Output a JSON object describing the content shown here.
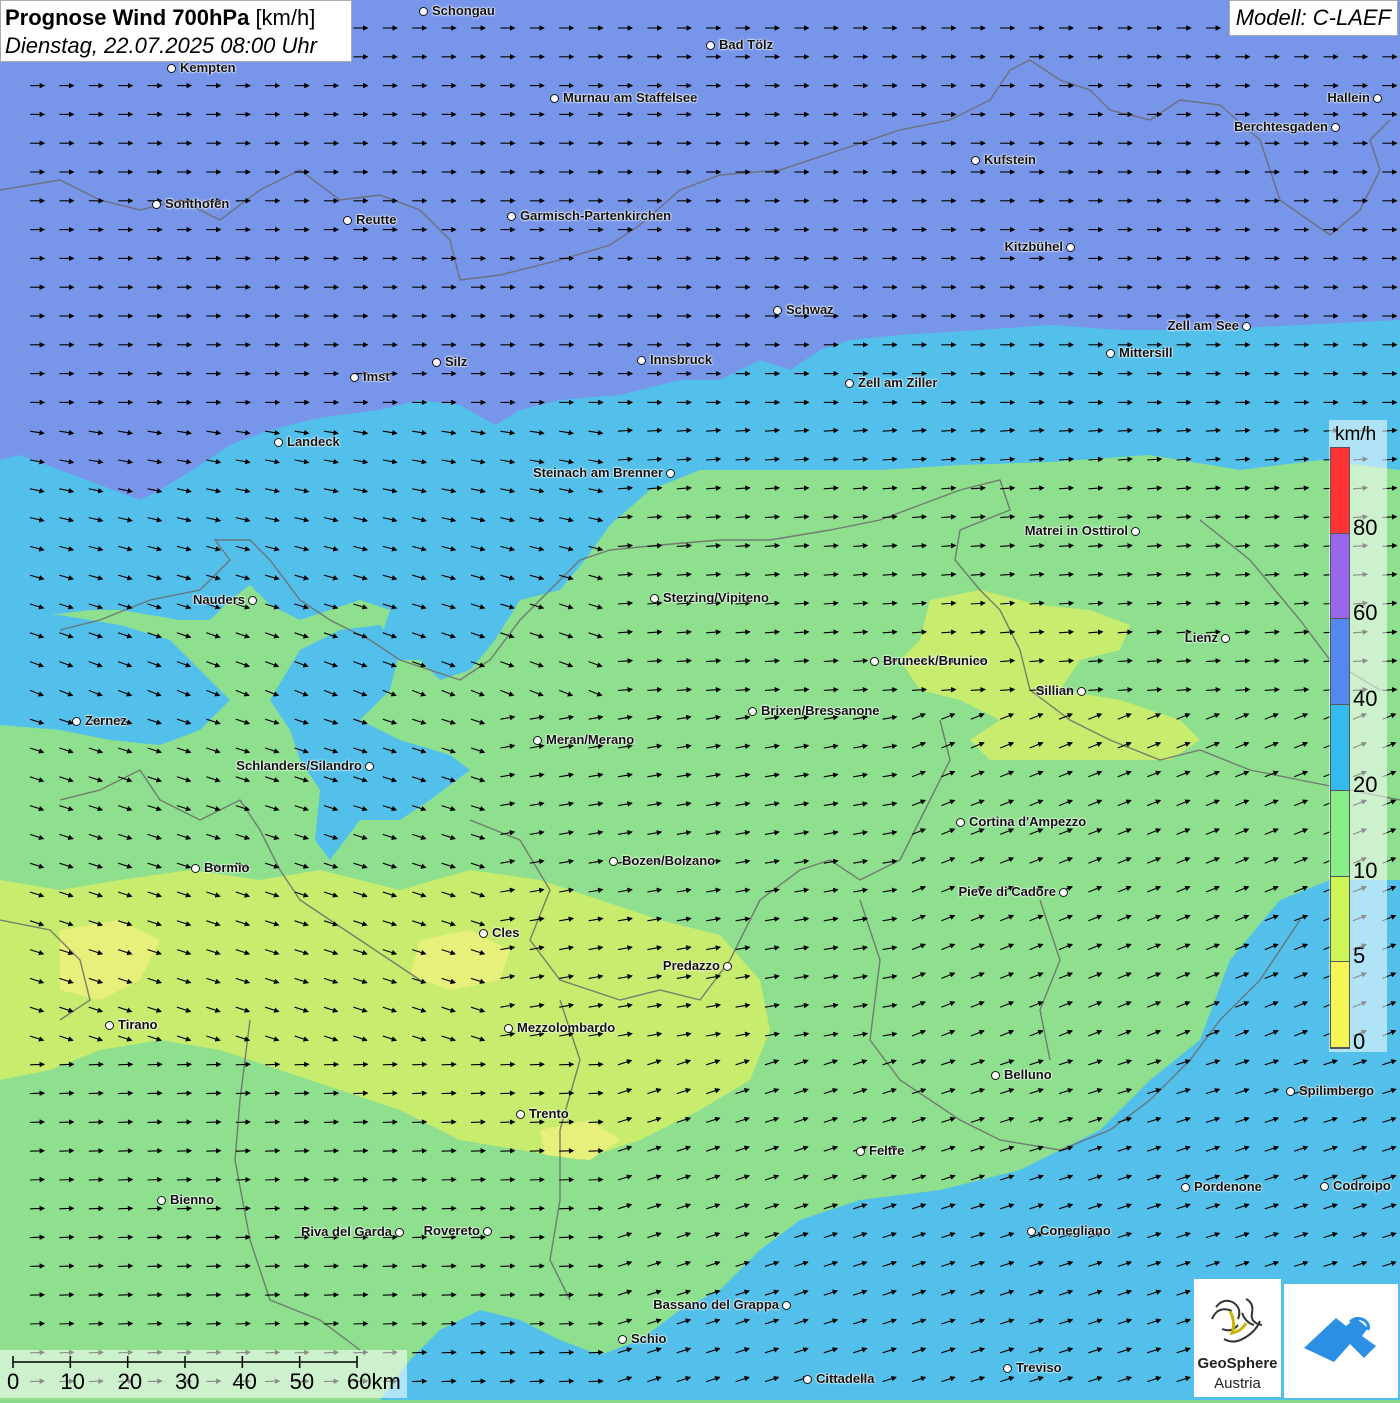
{
  "title": {
    "main": "Prognose Wind 700hPa",
    "unit": "[km/h]",
    "datetime": "Dienstag, 22.07.2025 08:00 Uhr"
  },
  "model": "Modell: C-LAEF",
  "legend": {
    "unit": "km/h",
    "labels": [
      "80",
      "60",
      "40",
      "20",
      "10",
      "5",
      "0"
    ],
    "colors": [
      "#ff3333",
      "#9966ee",
      "#5588ee",
      "#33bbee",
      "#88ee88",
      "#ccf555",
      "#f5f555"
    ]
  },
  "scale": {
    "labels": [
      "0",
      "10",
      "20",
      "30",
      "40",
      "50",
      "60km"
    ]
  },
  "logo": {
    "line1": "GeoSphere",
    "line2": "Austria"
  },
  "colors": {
    "wind_40_60": "#7896e9",
    "wind_20_40": "#52c0ea",
    "wind_10_20": "#8ee08e",
    "wind_5_10": "#c8ec6e",
    "wind_0_5": "#e7f07a"
  },
  "cities": [
    {
      "name": "Schongau"
    },
    {
      "name": "Bad Tölz"
    },
    {
      "name": "Kempten"
    },
    {
      "name": "Murnau am Staffelsee"
    },
    {
      "name": "Hallein"
    },
    {
      "name": "Berchtesgaden"
    },
    {
      "name": "Kufstein"
    },
    {
      "name": "Sonthofen"
    },
    {
      "name": "Reutte"
    },
    {
      "name": "Garmisch-Partenkirchen"
    },
    {
      "name": "Kitzbühel"
    },
    {
      "name": "Schwaz"
    },
    {
      "name": "Zell am See"
    },
    {
      "name": "Mittersill"
    },
    {
      "name": "Innsbruck"
    },
    {
      "name": "Silz"
    },
    {
      "name": "Imst"
    },
    {
      "name": "Zell am Ziller"
    },
    {
      "name": "Landeck"
    },
    {
      "name": "Steinach am Brenner"
    },
    {
      "name": "Matrei in Osttirol"
    },
    {
      "name": "Nauders"
    },
    {
      "name": "Sterzing/Vipiteno"
    },
    {
      "name": "Lienz"
    },
    {
      "name": "Bruneck/Brunico"
    },
    {
      "name": "Sillian"
    },
    {
      "name": "Zernez"
    },
    {
      "name": "Brixen/Bressanone"
    },
    {
      "name": "Meran/Merano"
    },
    {
      "name": "Schlanders/Silandro"
    },
    {
      "name": "Cortina d'Ampezzo"
    },
    {
      "name": "Bozen/Bolzano"
    },
    {
      "name": "Bormio"
    },
    {
      "name": "Pieve di Cadore"
    },
    {
      "name": "Cles"
    },
    {
      "name": "Predazzo"
    },
    {
      "name": "Tirano"
    },
    {
      "name": "Mezzolombardo"
    },
    {
      "name": "Belluno"
    },
    {
      "name": "Spilimbergo"
    },
    {
      "name": "Trento"
    },
    {
      "name": "Feltre"
    },
    {
      "name": "Pordenone"
    },
    {
      "name": "Codroipo"
    },
    {
      "name": "Bienno"
    },
    {
      "name": "Riva del Garda"
    },
    {
      "name": "Rovereto"
    },
    {
      "name": "Conegliano"
    },
    {
      "name": "Bassano del Grappa"
    },
    {
      "name": "Schio"
    },
    {
      "name": "Treviso"
    },
    {
      "name": "Cittadella"
    }
  ]
}
